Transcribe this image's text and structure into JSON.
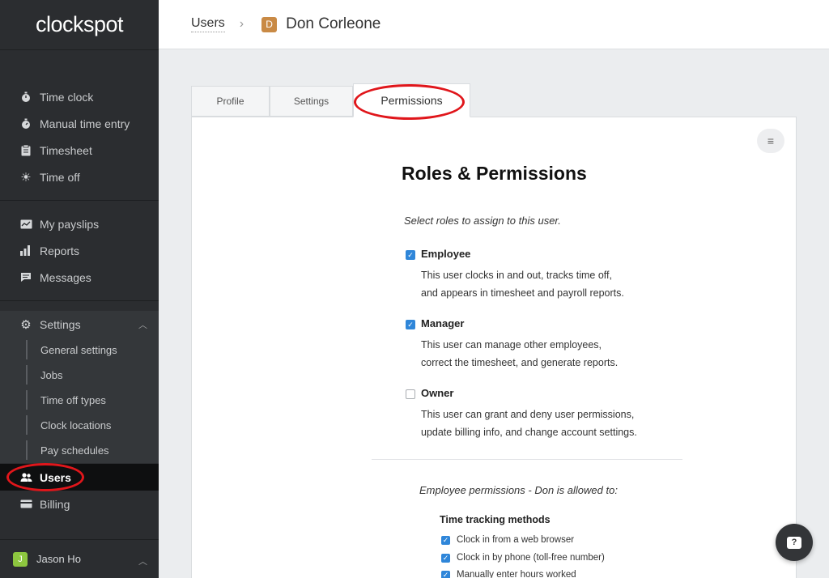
{
  "app": {
    "logo": "clockspot"
  },
  "sidebar": {
    "items": [
      {
        "label": "Time clock",
        "icon": "stopwatch-icon"
      },
      {
        "label": "Manual time entry",
        "icon": "stopwatch-icon"
      },
      {
        "label": "Timesheet",
        "icon": "clipboard-icon"
      },
      {
        "label": "Time off",
        "icon": "sun-icon"
      },
      {
        "label": "My payslips",
        "icon": "payslip-icon"
      },
      {
        "label": "Reports",
        "icon": "bar-chart-icon"
      },
      {
        "label": "Messages",
        "icon": "message-icon"
      },
      {
        "label": "Settings",
        "icon": "gears-icon"
      },
      {
        "label": "Users",
        "icon": "users-icon"
      },
      {
        "label": "Billing",
        "icon": "credit-card-icon"
      }
    ],
    "settings_sub": [
      "General settings",
      "Jobs",
      "Time off types",
      "Clock locations",
      "Pay schedules"
    ],
    "current_user": {
      "initial": "J",
      "name": "Jason Ho"
    }
  },
  "header": {
    "breadcrumb": "Users",
    "user_initial": "D",
    "user_name": "Don Corleone"
  },
  "tabs": [
    "Profile",
    "Settings",
    "Permissions"
  ],
  "card": {
    "title": "Roles & Permissions",
    "intro": "Select roles to assign to this user.",
    "roles": [
      {
        "name": "Employee",
        "checked": true,
        "desc1": "This user clocks in and out, tracks time off,",
        "desc2": "and appears in timesheet and payroll reports."
      },
      {
        "name": "Manager",
        "checked": true,
        "desc1": "This user can manage other employees,",
        "desc2": "correct the timesheet, and generate reports."
      },
      {
        "name": "Owner",
        "checked": false,
        "desc1": "This user can grant and deny user permissions,",
        "desc2": "update billing info, and change account settings."
      }
    ],
    "perm_intro": "Employee permissions - Don is allowed to:",
    "perm_heading": "Time tracking methods",
    "perms": [
      {
        "label": "Clock in from a web browser",
        "checked": true
      },
      {
        "label": "Clock in by phone (toll-free number)",
        "checked": true
      },
      {
        "label": "Manually enter hours worked",
        "checked": true
      }
    ]
  },
  "colors": {
    "sidebar": "#2b2d30",
    "accent": "#2f86d9",
    "highlight": "#e0161b"
  }
}
